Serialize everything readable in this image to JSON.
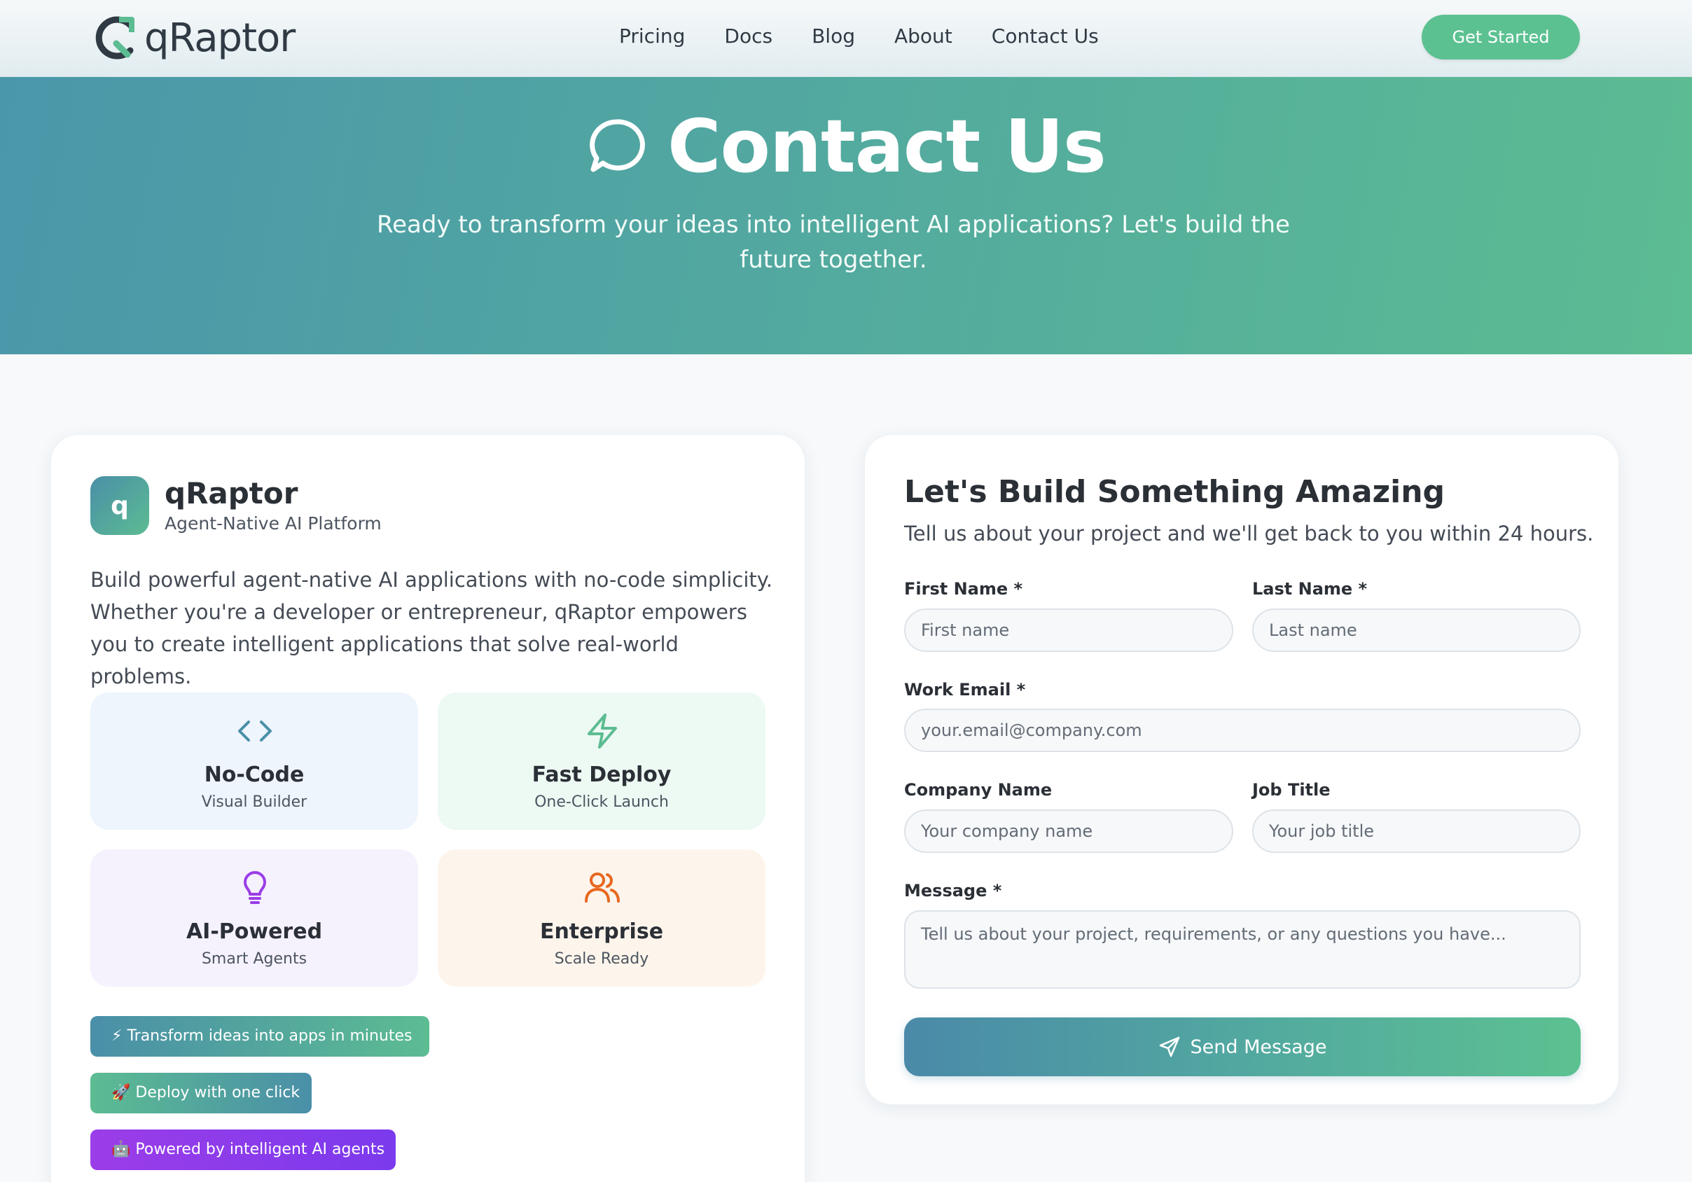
{
  "nav": {
    "brand": "qRaptor",
    "links": [
      "Pricing",
      "Docs",
      "Blog",
      "About",
      "Contact Us"
    ],
    "cta": "Get Started"
  },
  "hero": {
    "icon": "chat-bubble-icon",
    "title": "Contact Us",
    "subtitle": "Ready to transform your ideas into intelligent AI applications? Let's build the future together."
  },
  "about": {
    "avatar_letter": "q",
    "name": "qRaptor",
    "tagline": "Agent-Native AI Platform",
    "description": "Build powerful agent-native AI applications with no-code simplicity. Whether you're a developer or entrepreneur, qRaptor empowers you to create intelligent applications that solve real-world problems.",
    "features": [
      {
        "icon": "code-icon",
        "title": "No-Code",
        "subtitle": "Visual Builder",
        "color": "#4a8fa8"
      },
      {
        "icon": "lightning-icon",
        "title": "Fast Deploy",
        "subtitle": "One-Click Launch",
        "color": "#5cbc92"
      },
      {
        "icon": "lightbulb-icon",
        "title": "AI-Powered",
        "subtitle": "Smart Agents",
        "color": "#9b3de8"
      },
      {
        "icon": "users-icon",
        "title": "Enterprise",
        "subtitle": "Scale Ready",
        "color": "#e8681f"
      }
    ],
    "pills": [
      "⚡ Transform ideas into apps in minutes",
      "🚀 Deploy with one click",
      "🤖 Powered by intelligent AI agents"
    ]
  },
  "form": {
    "title": "Let's Build Something Amazing",
    "subtitle": "Tell us about your project and we'll get back to you within 24 hours.",
    "first_name": {
      "label": "First Name *",
      "placeholder": "First name",
      "value": ""
    },
    "last_name": {
      "label": "Last Name *",
      "placeholder": "Last name",
      "value": ""
    },
    "email": {
      "label": "Work Email *",
      "placeholder": "your.email@company.com",
      "value": ""
    },
    "company": {
      "label": "Company Name",
      "placeholder": "Your company name",
      "value": ""
    },
    "job_title": {
      "label": "Job Title",
      "placeholder": "Your job title",
      "value": ""
    },
    "message": {
      "label": "Message *",
      "placeholder": "Tell us about your project, requirements, or any questions you have...",
      "value": ""
    },
    "submit": "Send Message"
  },
  "colors": {
    "accent_green": "#5cc191",
    "accent_teal": "#4a97aa",
    "accent_purple": "#9b3de8",
    "accent_orange": "#e8681f"
  }
}
